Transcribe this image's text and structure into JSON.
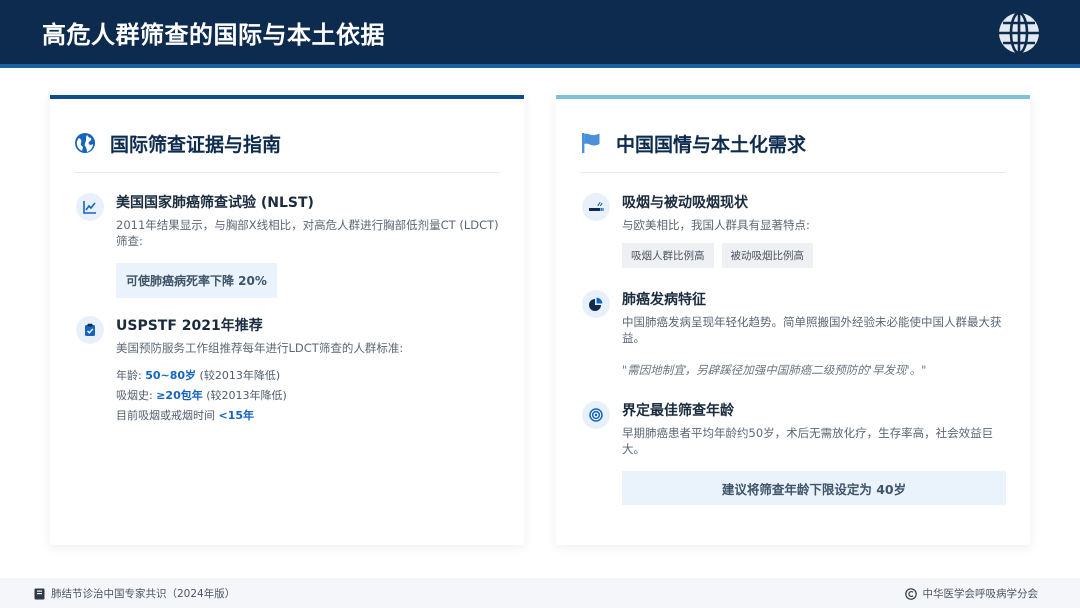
{
  "header": {
    "title": "高危人群筛查的国际与本土依据",
    "logo_icon": "globe-icon"
  },
  "left_card": {
    "title": "国际筛查证据与指南",
    "icon": "globe-icon",
    "nlst": {
      "icon": "chart-line-icon",
      "title": "美国国家肺癌筛查试验 (NLST)",
      "text": "2011年结果显示，与胸部X线相比，对高危人群进行胸部低剂量CT (LDCT) 筛查:",
      "highlight": "可使肺癌病死率下降 20%"
    },
    "uspstf": {
      "icon": "clipboard-check-icon",
      "title": "USPSTF 2021年推荐",
      "text": "美国预防服务工作组推荐每年进行LDCT筛查的人群标准:",
      "criteria": [
        {
          "label": "年龄: ",
          "value": "50~80岁",
          "note": " (较2013年降低)"
        },
        {
          "label": "吸烟史: ",
          "value": "≥20包年",
          "note": " (较2013年降低)"
        },
        {
          "label": "目前吸烟或戒烟时间 ",
          "value": "<15年",
          "note": ""
        }
      ]
    }
  },
  "right_card": {
    "title": "中国国情与本土化需求",
    "icon": "flag-icon",
    "smoking": {
      "icon": "cigarette-icon",
      "title": "吸烟与被动吸烟现状",
      "text": "与欧美相比，我国人群具有显著特点:",
      "tags": [
        "吸烟人群比例高",
        "被动吸烟比例高"
      ]
    },
    "features": {
      "icon": "pie-chart-icon",
      "title": "肺癌发病特征",
      "text": "中国肺癌发病呈现年轻化趋势。简单照搬国外经验未必能使中国人群最大获益。",
      "quote": "\"需因地制宜，另辟蹊径加强中国肺癌二级预防的'早发现'。\""
    },
    "age": {
      "icon": "target-icon",
      "title": "界定最佳筛查年龄",
      "text": "早期肺癌患者平均年龄约50岁，术后无需放化疗，生存率高，社会效益巨大。",
      "recommendation": "建议将筛查年龄下限设定为 40岁"
    }
  },
  "footer": {
    "source": "肺结节诊治中国专家共识（2024年版）",
    "source_icon": "book-icon",
    "copyright": "中华医学会呼吸病学分会",
    "copyright_icon": "copyright-icon"
  },
  "colors": {
    "header_bg": "#0d2b4e",
    "accent_blue": "#1565c0",
    "left_card_border": "#0d4f8b",
    "right_card_border": "#7fc0dd"
  }
}
